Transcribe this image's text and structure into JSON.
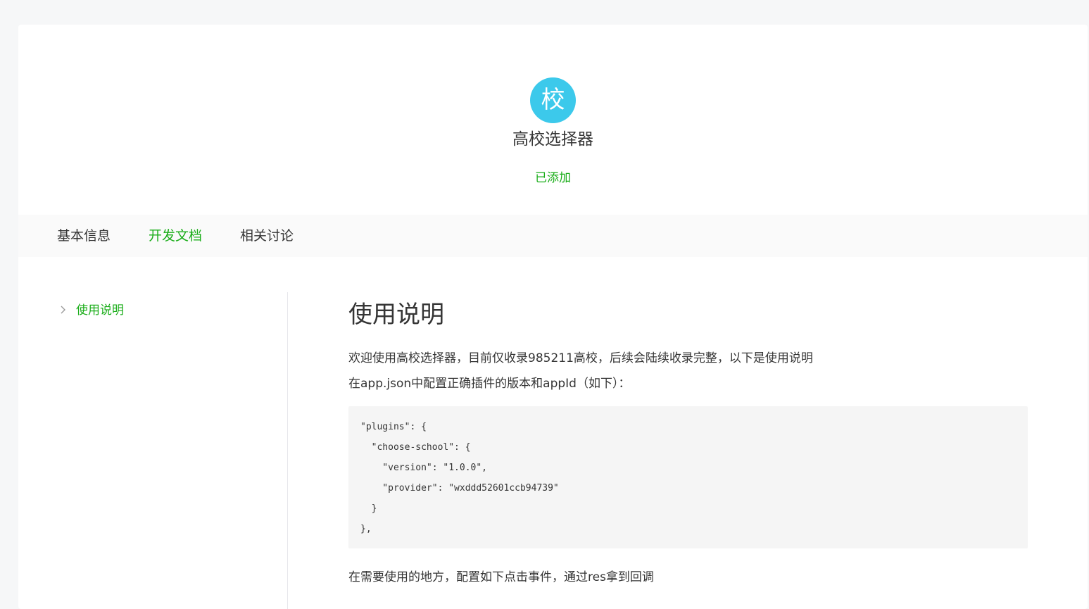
{
  "plugin": {
    "logo_char": "校",
    "name": "高校选择器",
    "status": "已添加"
  },
  "tabs": [
    {
      "label": "基本信息",
      "active": false
    },
    {
      "label": "开发文档",
      "active": true
    },
    {
      "label": "相关讨论",
      "active": false
    }
  ],
  "doc_nav": {
    "items": [
      {
        "label": "使用说明",
        "active": true
      }
    ]
  },
  "doc": {
    "title": "使用说明",
    "paragraphs": [
      "欢迎使用高校选择器，目前仅收录985211高校，后续会陆续收录完整，以下是使用说明",
      "在app.json中配置正确插件的版本和appId（如下）：",
      "在需要使用的地方，配置如下点击事件，通过res拿到回调"
    ],
    "code_lines": [
      "\"plugins\": {",
      "  \"choose-school\": {",
      "    \"version\": \"1.0.0\",",
      "    \"provider\": \"wxddd52601ccb94739\"",
      "  }",
      "},"
    ]
  },
  "colors": {
    "accent": "#1aad19",
    "logo_bg": "#3cc9eb",
    "page_bg": "#f6f7f8",
    "tab_bar_bg": "#fafafa",
    "code_bg": "#f5f5f5"
  }
}
